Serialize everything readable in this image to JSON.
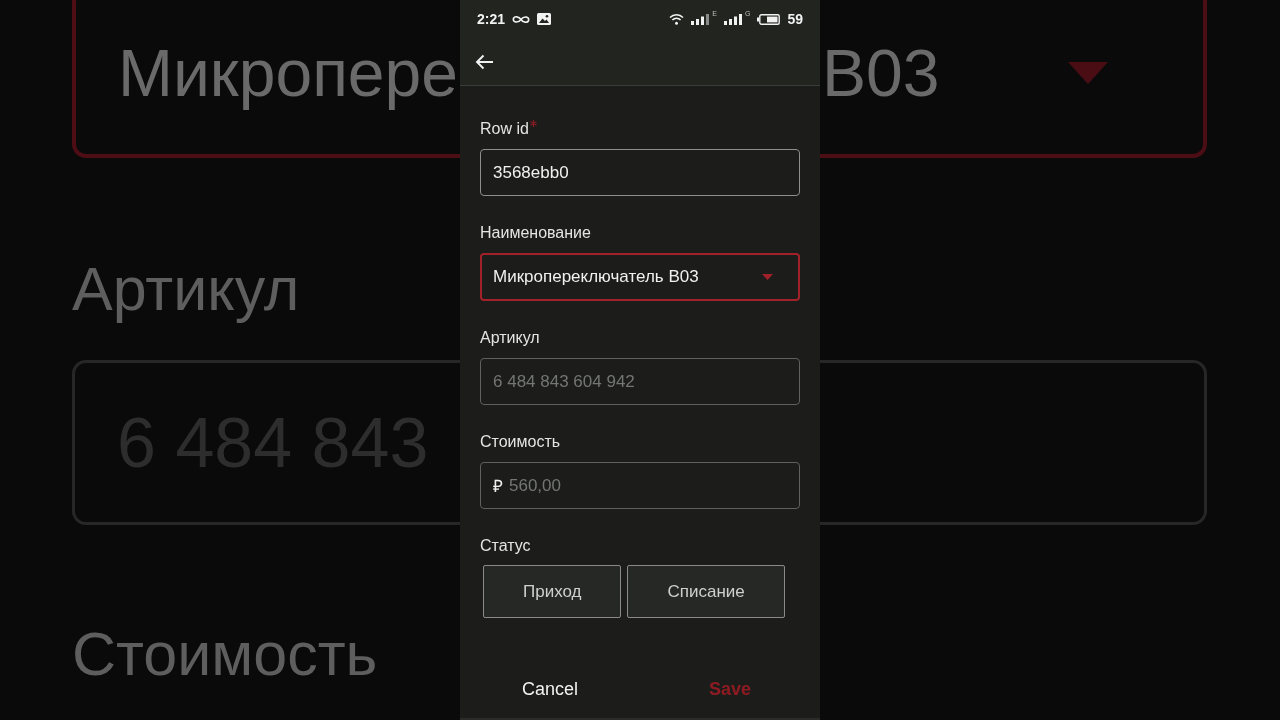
{
  "backdrop": {
    "left": {
      "name_value": "Микропере",
      "article_label": "Артикул",
      "article_value": "6 484 843",
      "cost_label": "Стоимость"
    },
    "right": {
      "name_value": "B03"
    }
  },
  "status_bar": {
    "time": "2:21",
    "network_1": "E",
    "network_2": "G",
    "battery": "59"
  },
  "form": {
    "fields": [
      {
        "kind": "text",
        "label": "Row id",
        "required": true,
        "focused": false,
        "value": "3568ebb0"
      },
      {
        "kind": "select",
        "label": "Наименование",
        "required": false,
        "focused": true,
        "value": "Микропереключатель B03"
      },
      {
        "kind": "text",
        "label": "Артикул",
        "required": false,
        "focused": false,
        "placeholder": "6 484 843 604 942"
      },
      {
        "kind": "currency",
        "label": "Стоимость",
        "required": false,
        "focused": false,
        "prefix": "₽",
        "placeholder": "560,00"
      }
    ],
    "status": {
      "label": "Статус",
      "options": [
        {
          "label": "Приход",
          "selected": false
        },
        {
          "label": "Списание",
          "selected": false
        }
      ]
    }
  },
  "footer": {
    "cancel": "Cancel",
    "save": "Save"
  }
}
